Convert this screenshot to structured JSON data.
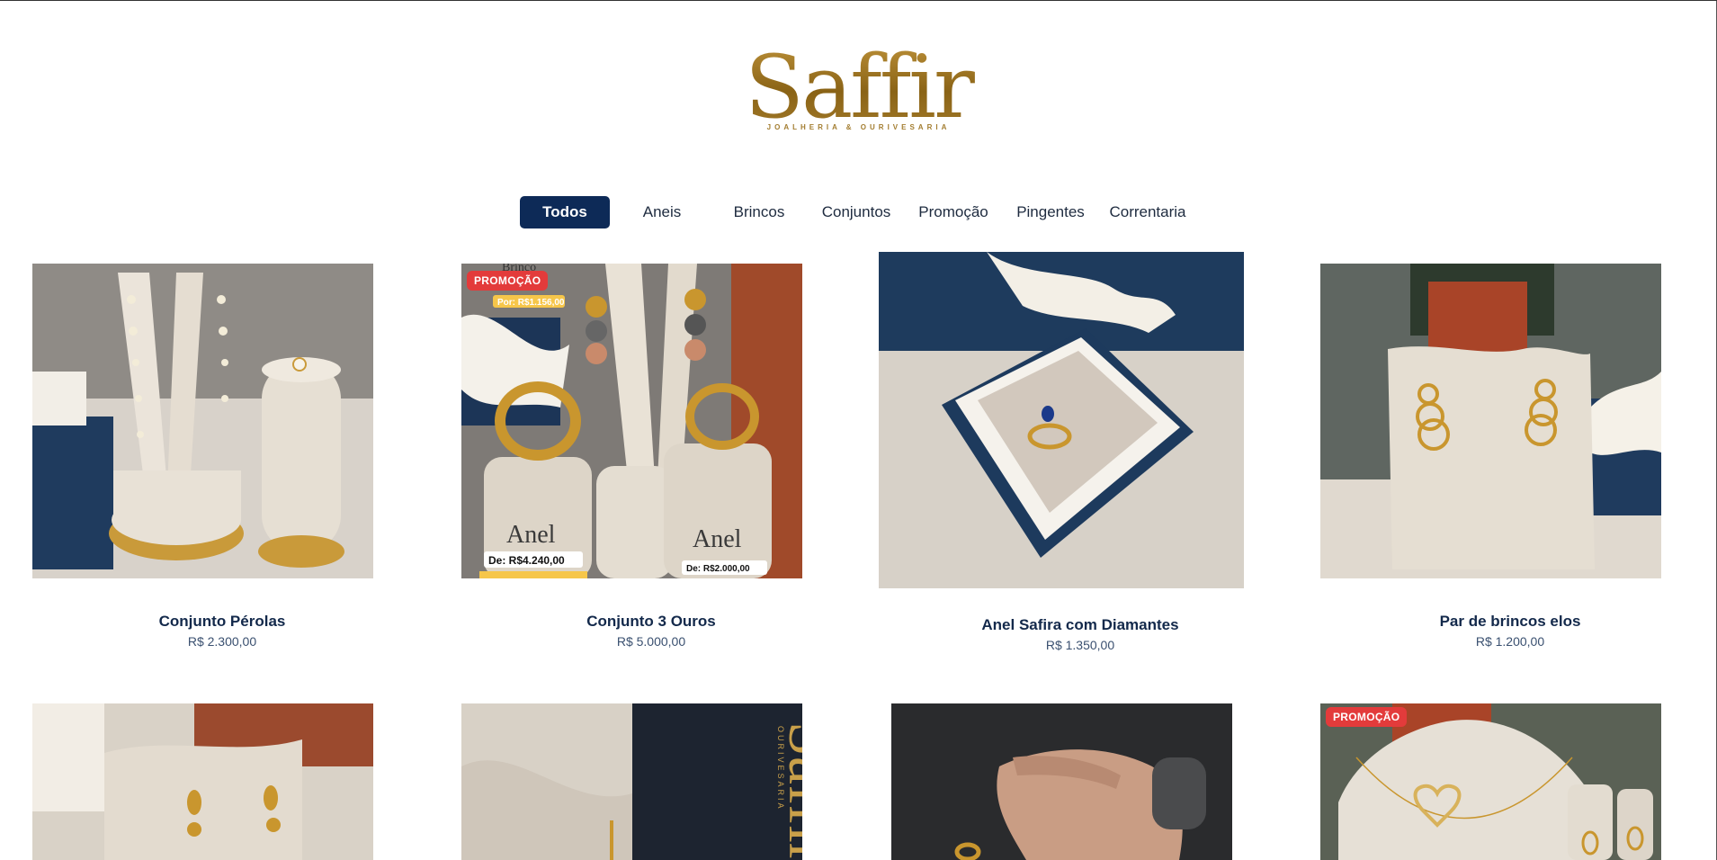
{
  "brand": {
    "name": "Saffir",
    "tagline": "JOALHERIA & OURIVESARIA"
  },
  "nav": {
    "items": [
      {
        "label": "Todos",
        "active": true
      },
      {
        "label": "Aneis",
        "active": false
      },
      {
        "label": "Brincos",
        "active": false
      },
      {
        "label": "Conjuntos",
        "active": false
      },
      {
        "label": "Promoção",
        "active": false
      },
      {
        "label": "Pingentes",
        "active": false
      },
      {
        "label": "Correntaria",
        "active": false
      }
    ]
  },
  "products": [
    {
      "name": "Conjunto Pérolas",
      "price": "R$ 2.300,00",
      "badge": ""
    },
    {
      "name": "Conjunto 3 Ouros",
      "price": "R$ 5.000,00",
      "badge": "PROMOÇÃO",
      "image_text": {
        "tag1": "Por: R$1.156,00",
        "tag2": "De: R$4.240,00",
        "tag3": "De: R$2.000,00",
        "stand1": "Anel",
        "stand2": "Anel",
        "top": "Brinco"
      }
    },
    {
      "name": "Anel Safira com Diamantes",
      "price": "R$ 1.350,00",
      "badge": ""
    },
    {
      "name": "Par de brincos elos",
      "price": "R$ 1.200,00",
      "badge": ""
    },
    {
      "name": "",
      "price": "",
      "badge": ""
    },
    {
      "name": "",
      "price": "",
      "badge": "",
      "image_text": {
        "logo": "Saffir",
        "tagline": "OURIVESARIA"
      }
    },
    {
      "name": "",
      "price": "",
      "badge": ""
    },
    {
      "name": "",
      "price": "",
      "badge": "PROMOÇÃO"
    }
  ],
  "colors": {
    "nav_active_bg": "#0d2a57",
    "badge_red": "#e33b3b",
    "gold": "#9c7422",
    "text_navy": "#13294b"
  }
}
